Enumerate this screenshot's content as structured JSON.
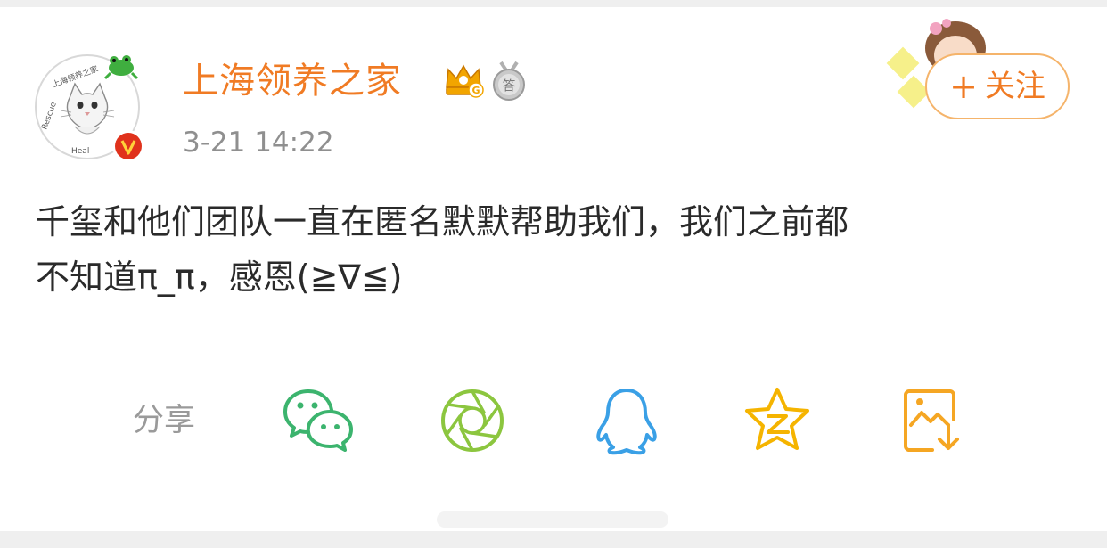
{
  "post": {
    "username": "上海领养之家",
    "timestamp": "3-21 14:22",
    "text_line1": "千玺和他们团队一直在匿名默默帮助我们，我们之前都",
    "text_line2": "不知道π_π，感恩(≧∇≦)"
  },
  "avatar": {
    "ring_text": "上海领养之家",
    "ring_text_en_1": "Rescue",
    "ring_text_en_2": "Heal"
  },
  "badges": {
    "crown_letter": "G",
    "medal_char": "答"
  },
  "follow_button": {
    "plus": "+",
    "label": "关注"
  },
  "share": {
    "label": "分享",
    "targets": [
      {
        "name": "wechat",
        "icon": "wechat-icon",
        "color": "#3cb46e"
      },
      {
        "name": "moments",
        "icon": "moments-aperture-icon",
        "color": "#8cc63f"
      },
      {
        "name": "qq",
        "icon": "qq-penguin-icon",
        "color": "#3aa0e6"
      },
      {
        "name": "qzone",
        "icon": "qzone-star-icon",
        "color": "#f5b400"
      },
      {
        "name": "save-image",
        "icon": "save-image-icon",
        "color": "#f5a623"
      }
    ]
  },
  "colors": {
    "accent": "#f07b24",
    "follow_border": "#f5b46b",
    "verified": "#e0321c",
    "text": "#2a2a2a",
    "muted": "#8f8f8f"
  }
}
